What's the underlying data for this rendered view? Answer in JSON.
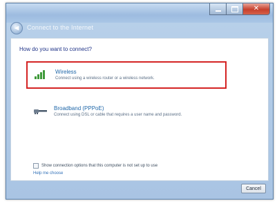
{
  "window": {
    "nav_title": "Connect to the Internet",
    "back_glyph": "◄"
  },
  "main": {
    "question": "How do you want to connect?",
    "options": [
      {
        "title": "Wireless",
        "description": "Connect using a wireless router or a wireless network.",
        "icon": "wireless-signal-icon",
        "selected": true
      },
      {
        "title": "Broadband (PPPoE)",
        "description": "Connect using DSL or cable that requires a user name and password.",
        "icon": "broadband-cable-icon",
        "selected": false
      }
    ],
    "checkbox_label": "Show connection options that this computer is not set up to use",
    "help_link": "Help me choose"
  },
  "footer": {
    "cancel_label": "Cancel"
  },
  "colors": {
    "accent_red": "#d42222",
    "link_blue": "#1e66a8",
    "signal_green": "#3f9a3a"
  }
}
